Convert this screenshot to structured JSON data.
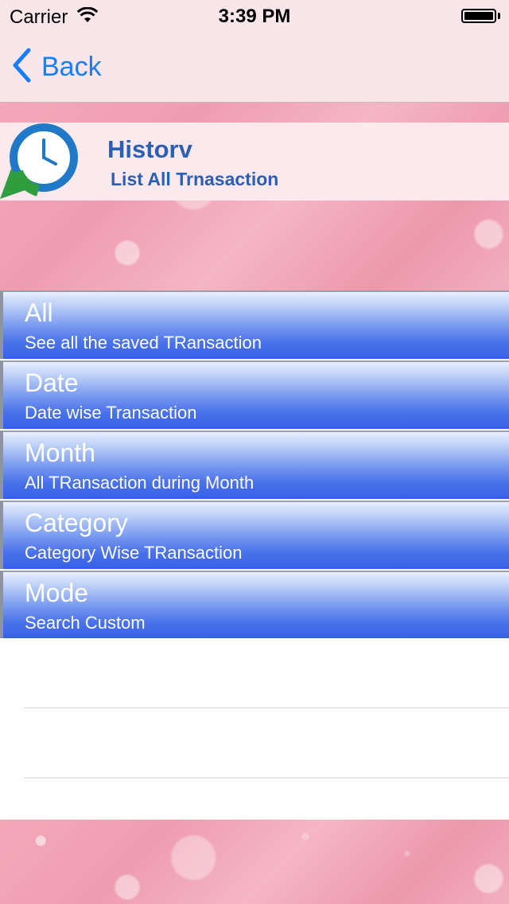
{
  "status_bar": {
    "carrier": "Carrier",
    "time": "3:39 PM"
  },
  "nav": {
    "back_label": "Back"
  },
  "header": {
    "title": "Historv",
    "subtitle": "List All Trnasaction",
    "icon": "history-clock-icon"
  },
  "menu": {
    "items": [
      {
        "title": "All",
        "description": "See all the saved TRansaction"
      },
      {
        "title": "Date",
        "description": "Date wise Transaction"
      },
      {
        "title": "Month",
        "description": "All TRansaction during Month"
      },
      {
        "title": "Category",
        "description": "Category Wise TRansaction"
      },
      {
        "title": "Mode",
        "description": "Search Custom"
      }
    ]
  },
  "colors": {
    "accent": "#167efb",
    "header_text": "#2a5fb8",
    "menu_blue": "#3561e5",
    "pink_background": "#f3a9b9"
  }
}
